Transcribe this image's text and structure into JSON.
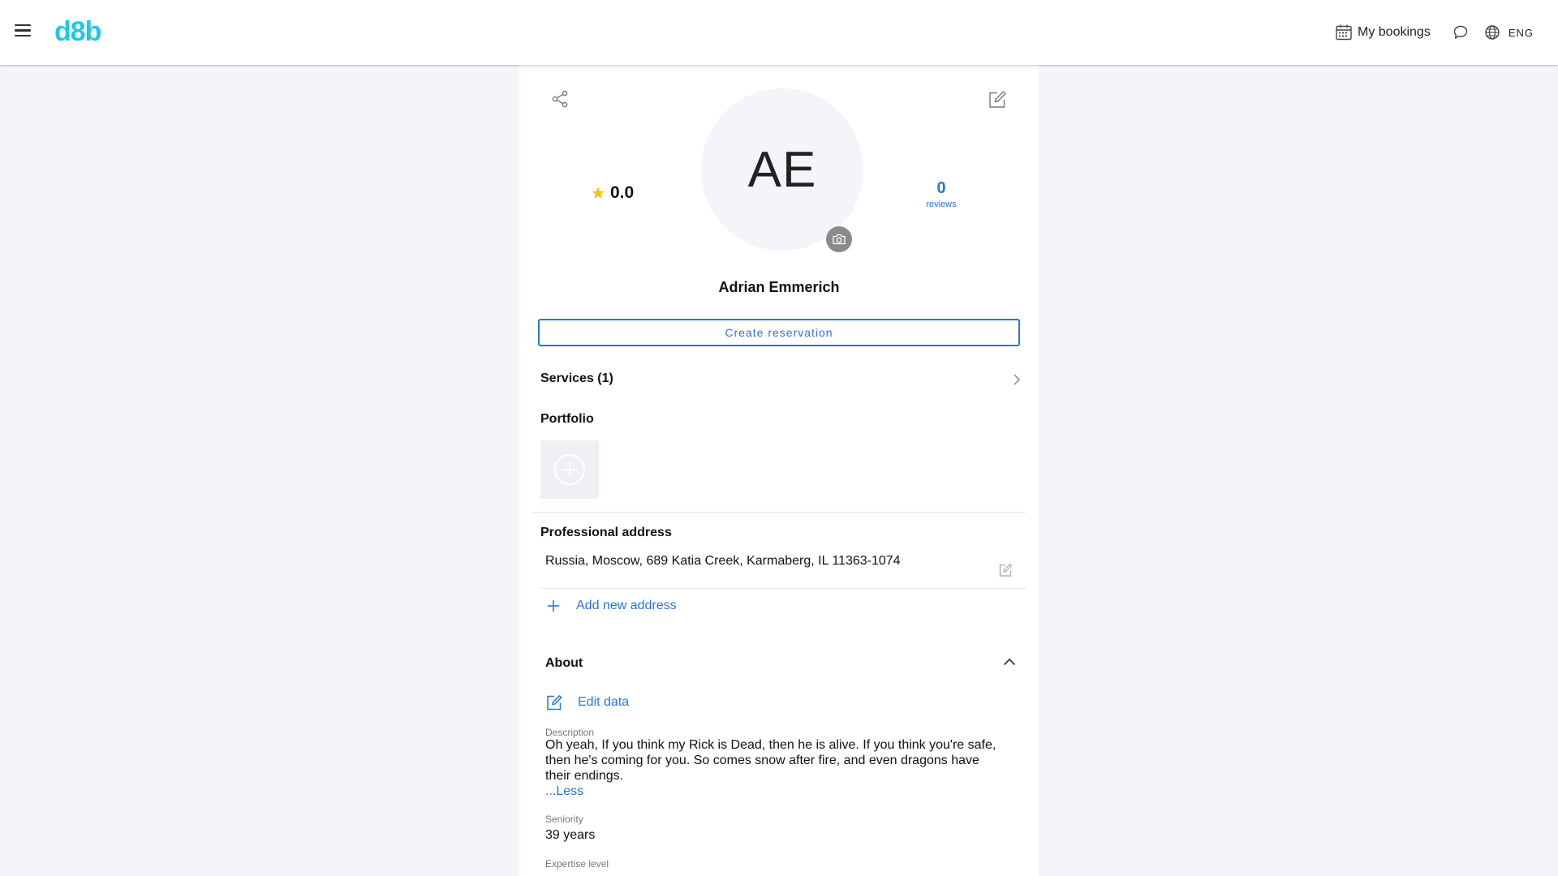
{
  "header": {
    "logo": "d8b",
    "bookings_label": "My bookings",
    "language": "ENG",
    "brand_color": "#1ec8e6",
    "icons": [
      "hamburger-menu-icon",
      "calendar-icon",
      "chat-icon",
      "globe-icon"
    ]
  },
  "profile": {
    "initials": "AE",
    "name": "Adrian Emmerich",
    "rating": "0.0",
    "reviews_count": "0",
    "reviews_label": "reviews",
    "reserve_label": "Create reservation",
    "accent_color": "#2b74e0",
    "star_color": "#f5c518"
  },
  "services": {
    "title": "Services (1)"
  },
  "portfolio": {
    "title": "Portfolio"
  },
  "address": {
    "title": "Professional address",
    "value": "Russia, Moscow, 689 Katia Creek, Karmaberg, IL 11363-1074",
    "add_label": "Add new address"
  },
  "about": {
    "title": "About",
    "edit_label": "Edit data",
    "description_label": "Description",
    "description": "Oh yeah, If you think my Rick is Dead, then he is alive. If you think you're safe, then he's coming for you. So comes snow after fire, and even dragons have their endings.",
    "less_label": "...Less",
    "seniority_label": "Seniority",
    "seniority": "39 years",
    "expertise_label": "Expertise level"
  }
}
